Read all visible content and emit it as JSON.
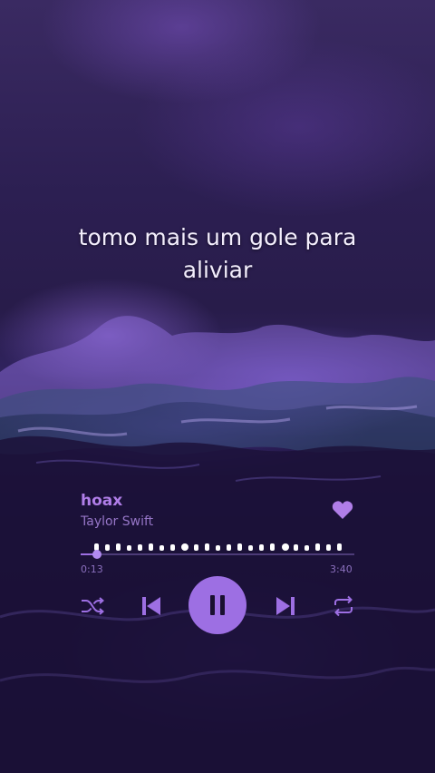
{
  "lyrics": {
    "line1": "tomo mais um gole para",
    "line2": "aliviar"
  },
  "track": {
    "title": "hoax",
    "artist": "Taylor Swift",
    "elapsed": "0:13",
    "duration": "3:40",
    "progress": 0.06,
    "liked": true
  },
  "controls": {
    "shuffle_icon": "shuffle-icon",
    "previous_icon": "skip-previous-icon",
    "play_state": "playing",
    "pause_icon": "pause-icon",
    "next_icon": "skip-next-icon",
    "repeat_icon": "repeat-icon"
  },
  "colors": {
    "accent": "#9d6fe3",
    "title": "#b07ee8",
    "artist": "#9575c6",
    "lyric": "#f3eefc"
  }
}
